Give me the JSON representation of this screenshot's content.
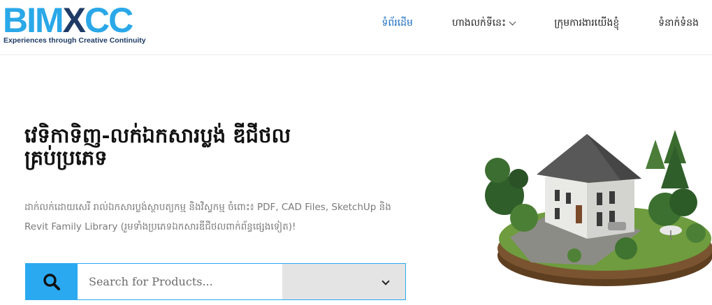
{
  "header": {
    "logo": {
      "part1": "BIM",
      "part2": "X",
      "part3": "CC",
      "tagline": "Experiences through Creative Continuity"
    },
    "nav": [
      {
        "label": "ទំព័រដើម",
        "active": true
      },
      {
        "label": "ហាងលក់ទីនេះ",
        "has_dropdown": true,
        "dropdown_icon": "chevron-down-icon"
      },
      {
        "label": "ក្រុមការងារយើងខ្ញុំ"
      },
      {
        "label": "ទំនាក់ទំនង"
      }
    ]
  },
  "hero": {
    "title": "វេទិកាទិញ-លក់ឯកសារប្លង់ ឌីជីថល គ្រប់ប្រភេទ",
    "description": "ដាក់លក់ដោយសេរី រាល់ឯកសារប្លង់ស្ថាបត្យកម្ម និងវិស្វកម្ម ចំពោះ៖ PDF, CAD Files, SketchUp និង Revit Family Library (រួមទាំងប្រភេទឯកសារឌីជីថលពាក់ព័ន្ធផ្សេងទៀត)!",
    "image": "villa-render-illustration"
  },
  "search": {
    "icon": "search-icon",
    "placeholder": "Search for Products...",
    "value": "",
    "category_selected": "",
    "category_icon": "chevron-down-icon"
  },
  "colors": {
    "brand_blue": "#2aa9f1",
    "brand_navy": "#1f3b66",
    "nav_active": "#1a6dc0",
    "select_bg": "#e4e4e4"
  }
}
